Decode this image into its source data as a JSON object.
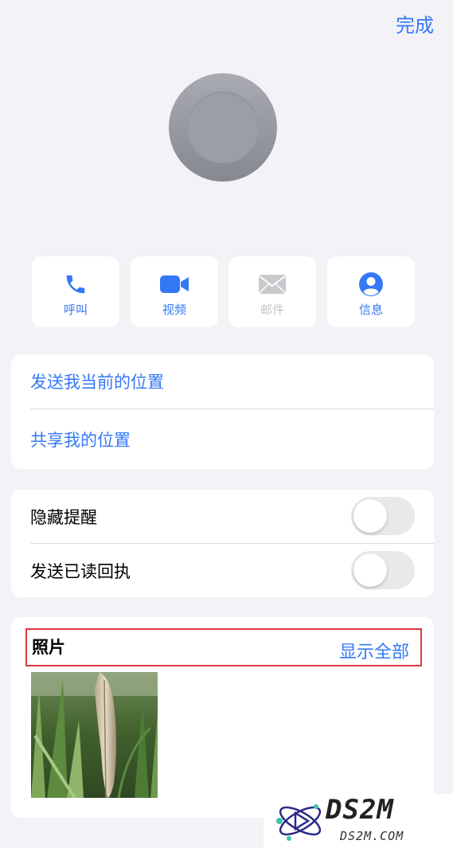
{
  "header": {
    "done_label": "完成"
  },
  "actions": [
    {
      "label": "呼叫",
      "icon": "phone-icon",
      "enabled": true
    },
    {
      "label": "视频",
      "icon": "video-icon",
      "enabled": true
    },
    {
      "label": "邮件",
      "icon": "mail-icon",
      "enabled": false
    },
    {
      "label": "信息",
      "icon": "person-info-icon",
      "enabled": true
    }
  ],
  "location": {
    "send_current": "发送我当前的位置",
    "share": "共享我的位置"
  },
  "settings": {
    "hide_alerts": {
      "label": "隐藏提醒",
      "on": false
    },
    "read_receipts": {
      "label": "发送已读回执",
      "on": false
    }
  },
  "photos": {
    "title": "照片",
    "show_all": "显示全部"
  },
  "watermark": {
    "main": "DS2M",
    "sub": "DS2M.COM"
  },
  "colors": {
    "accent": "#3478f6",
    "background": "#f2f2f7",
    "highlight": "#e0393a"
  }
}
